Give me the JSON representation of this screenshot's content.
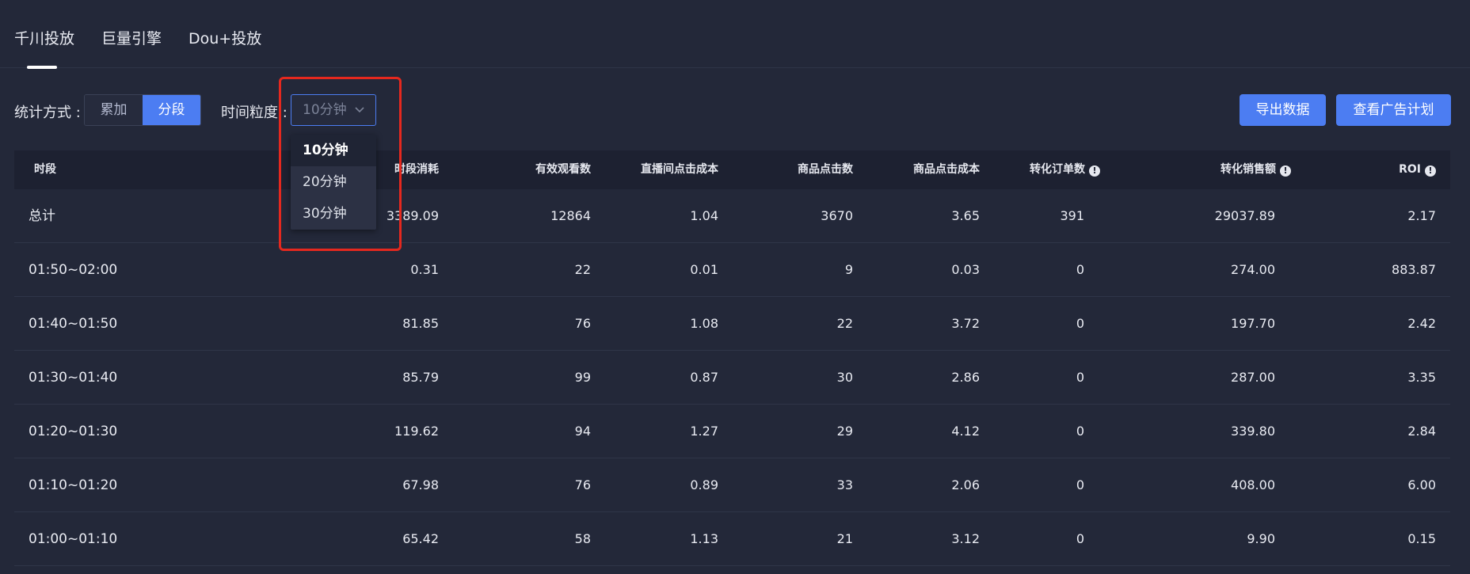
{
  "tabs": [
    "千川投放",
    "巨量引擎",
    "Dou+投放"
  ],
  "toolbar": {
    "stat_label": "统计方式 :",
    "stat_options": [
      "累加",
      "分段"
    ],
    "granularity_label": "时间粒度 :",
    "granularity_value": "10分钟",
    "granularity_options": [
      "10分钟",
      "20分钟",
      "30分钟"
    ],
    "export_button": "导出数据",
    "view_plan_button": "查看广告计划"
  },
  "colors": {
    "accent": "#4c7df2",
    "highlight": "#e5281e",
    "background": "#232839"
  },
  "table": {
    "headers": [
      "时段",
      "时段消耗",
      "有效观看数",
      "直播间点击成本",
      "商品点击数",
      "商品点击成本",
      "转化订单数",
      "转化销售额",
      "ROI"
    ],
    "rows": [
      [
        "总计",
        "3389.09",
        "12864",
        "1.04",
        "3670",
        "3.65",
        "391",
        "29037.89",
        "2.17"
      ],
      [
        "01:50~02:00",
        "0.31",
        "22",
        "0.01",
        "9",
        "0.03",
        "0",
        "274.00",
        "883.87"
      ],
      [
        "01:40~01:50",
        "81.85",
        "76",
        "1.08",
        "22",
        "3.72",
        "0",
        "197.70",
        "2.42"
      ],
      [
        "01:30~01:40",
        "85.79",
        "99",
        "0.87",
        "30",
        "2.86",
        "0",
        "287.00",
        "3.35"
      ],
      [
        "01:20~01:30",
        "119.62",
        "94",
        "1.27",
        "29",
        "4.12",
        "0",
        "339.80",
        "2.84"
      ],
      [
        "01:10~01:20",
        "67.98",
        "76",
        "0.89",
        "33",
        "2.06",
        "0",
        "408.00",
        "6.00"
      ],
      [
        "01:00~01:10",
        "65.42",
        "58",
        "1.13",
        "21",
        "3.12",
        "0",
        "9.90",
        "0.15"
      ]
    ]
  }
}
